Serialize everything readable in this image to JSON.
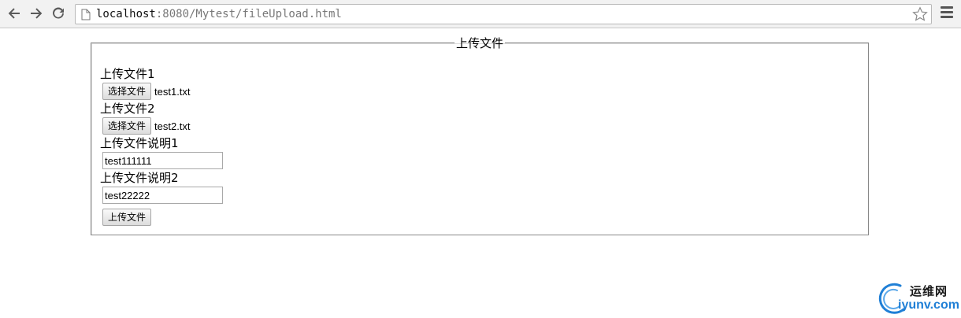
{
  "browser": {
    "url_host": "localhost",
    "url_path": ":8080/Mytest/fileUpload.html"
  },
  "form": {
    "legend": "上传文件",
    "file1_label": "上传文件1",
    "file1_button": "选择文件",
    "file1_name": "test1.txt",
    "file2_label": "上传文件2",
    "file2_button": "选择文件",
    "file2_name": "test2.txt",
    "desc1_label": "上传文件说明1",
    "desc1_value": "test111111",
    "desc2_label": "上传文件说明2",
    "desc2_value": "test22222",
    "submit_label": "上传文件"
  },
  "watermark": {
    "cn": "运维网",
    "en": "iyunv.com",
    "color": "#1f7fd6"
  },
  "icons": [
    "back-icon",
    "forward-icon",
    "reload-icon",
    "page-icon",
    "star-icon",
    "menu-icon"
  ]
}
